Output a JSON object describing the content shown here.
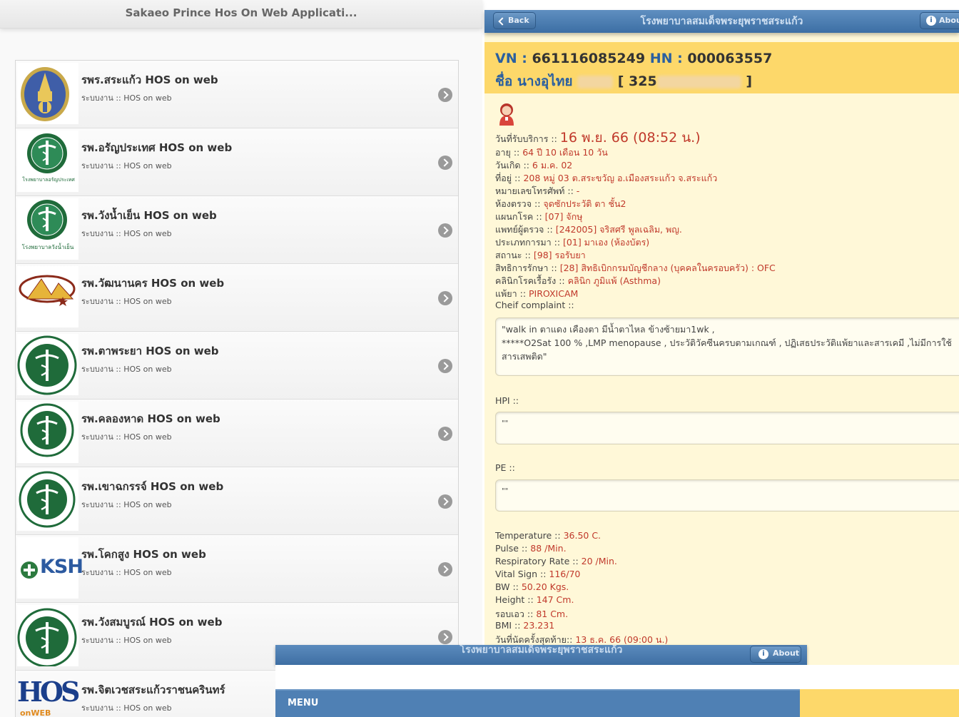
{
  "left_panel": {
    "header_title": "Sakaeo Prince Hos On Web Applicati...",
    "hospitals": [
      {
        "title": "รพร.สระแก้ว HOS on web",
        "subtitle": "ระบบงาน :: HOS on web",
        "logo": "royal-seal-logo"
      },
      {
        "title": "รพ.อรัญประเทศ HOS on web",
        "subtitle": "ระบบงาน :: HOS on web",
        "logo": "moph-logo",
        "logo_caption": "โรงพยาบาลอรัญประเทศ"
      },
      {
        "title": "รพ.วังน้ำเย็น HOS on web",
        "subtitle": "ระบบงาน :: HOS on web",
        "logo": "moph-logo",
        "logo_caption": "โรงพยาบาลวังน้ำเย็น"
      },
      {
        "title": "รพ.วัฒนานคร HOS on web",
        "subtitle": "ระบบงาน :: HOS on web",
        "logo": "mountain-logo"
      },
      {
        "title": "รพ.ตาพระยา HOS on web",
        "subtitle": "ระบบงาน :: HOS on web",
        "logo": "moph-round-logo"
      },
      {
        "title": "รพ.คลองหาด HOS on web",
        "subtitle": "ระบบงาน :: HOS on web",
        "logo": "moph-round-logo"
      },
      {
        "title": "รพ.เขาฉกรรจ์ HOS on web",
        "subtitle": "ระบบงาน :: HOS on web",
        "logo": "moph-round-logo"
      },
      {
        "title": "รพ.โคกสูง HOS on web",
        "subtitle": "ระบบงาน :: HOS on web",
        "logo": "ksh-logo",
        "logo_text": "KSH"
      },
      {
        "title": "รพ.วังสมบูรณ์ HOS on web",
        "subtitle": "ระบบงาน :: HOS on web",
        "logo": "moph-round-logo"
      },
      {
        "title": "รพ.จิตเวชสระแก้วราชนครินทร์",
        "subtitle": "ระบบงาน :: HOS on web",
        "logo": "hos-logo",
        "logo_text": "HOS",
        "logo_subtext": "onWEB"
      }
    ]
  },
  "right_panel": {
    "back_label": "Back",
    "header_title": "โรงพยาบาลสมเด็จพระยุพราชสระแก้ว",
    "about_label": "About",
    "vn_label": "VN : ",
    "vn_value": "661116085249",
    "hn_label": " HN : ",
    "hn_value": "000063557",
    "name_label": "ชื่อ ",
    "name_value": "นางอุไทย",
    "cid_prefix": "[ 325",
    "cid_suffix": " ]",
    "visit_label": "วันที่รับบริการ :: ",
    "visit_value": "16 พ.ย. 66 (08:52 น.)",
    "details": [
      {
        "label": "อายุ :: ",
        "value": "64 ปี 10 เดือน 10 วัน"
      },
      {
        "label": "วันเกิด :: ",
        "value": "6 ม.ค. 02"
      },
      {
        "label": "ที่อยู่ :: ",
        "value": "208 หมู่ 03 ต.สระขวัญ อ.เมืองสระแก้ว จ.สระแก้ว"
      },
      {
        "label": "หมายเลขโทรศัพท์ :: ",
        "value": "-"
      },
      {
        "label": "ห้องตรวจ :: ",
        "value": "จุดซักประวัติ ตา ชั้น2"
      },
      {
        "label": "แผนกโรค :: ",
        "value": "[07] จักษุ"
      },
      {
        "label": "แพทย์ผู้ตรวจ :: ",
        "value": "[242005] จริสศรี พูลเฉลิม, พญ."
      },
      {
        "label": "ประเภทการมา :: ",
        "value": "[01] มาเอง (ห้องบัตร)"
      },
      {
        "label": "สถานะ :: ",
        "value": "[98] รอรับยา"
      },
      {
        "label": "สิทธิการรักษา :: ",
        "value": "[28] สิทธิเบิกกรมบัญชีกลาง (บุคคลในครอบครัว) : OFC"
      },
      {
        "label": "คลินิกโรคเรื้อรัง :: ",
        "value": "คลินิก ภูมิแพ้ (Asthma)"
      },
      {
        "label": "แพ้ยา :: ",
        "value": "PIROXICAM"
      },
      {
        "label": "Cheif complaint ::",
        "value": ""
      }
    ],
    "chief_complaint": "\"walk in ตาแดง เคืองตา มีน้ำตาไหล ข้างซ้ายมา1wk ,\n*****O2Sat 100 %  ,LMP menopause  , ประวัติวัคซีนครบตามเกณฑ์ , ปฏิเสธประวัติแพ้ยาและสารเคมี ,ไม่มีการใช้\nสารเสพติด\"",
    "hpi_label": "HPI ::",
    "hpi_value": "\"\"",
    "pe_label": "PE ::",
    "pe_value": "\"\"",
    "vitals": [
      {
        "label": "Temperature :: ",
        "value": "36.50 C."
      },
      {
        "label": "Pulse :: ",
        "value": "88 /Min."
      },
      {
        "label": "Respiratory Rate :: ",
        "value": "20 /Min."
      },
      {
        "label": "Vital Sign :: ",
        "value": "116/70"
      },
      {
        "label": "BW :: ",
        "value": "50.20 Kgs."
      },
      {
        "label": "Height :: ",
        "value": "147 Cm."
      },
      {
        "label": "รอบเอว :: ",
        "value": "81 Cm."
      },
      {
        "label": "BMI :: ",
        "value": "23.231"
      },
      {
        "label": "วันที่นัดครั้งสุดท้าย:: ",
        "value": "13 ธ.ค. 66 (09:00 น.)"
      }
    ]
  },
  "bottom_overlay": {
    "header_title": "โรงพยาบาลสมเด็จพระยุพราชสระแก้ว",
    "about_label": "About",
    "menu_label": "MENU"
  },
  "colors": {
    "header_blue": "#3c6ea4",
    "band_yellow": "#fdd86a",
    "value_red": "#c0392b",
    "moph_green": "#1f6b3a"
  }
}
